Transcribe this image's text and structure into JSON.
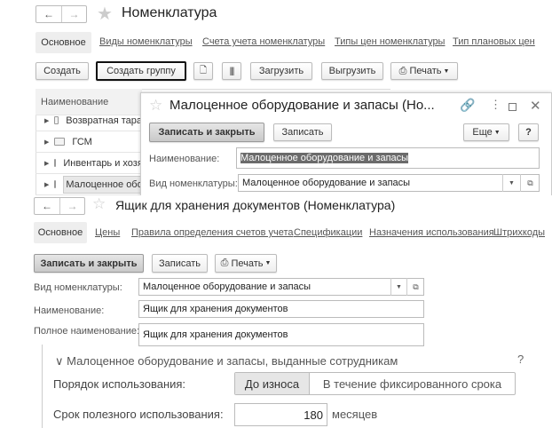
{
  "list_window": {
    "title": "Номенклатура",
    "tabs": [
      "Основное",
      "Виды номенклатуры",
      "Счета учета номенклатуры",
      "Типы цен номенклатуры",
      "Тип плановых цен"
    ],
    "toolbar": {
      "create": "Создать",
      "create_group": "Создать группу",
      "load": "Загрузить",
      "unload": "Выгрузить",
      "print": "Печать"
    },
    "column_header": "Наименование",
    "rows": [
      "Возвратная тара",
      "ГСМ",
      "Инвентарь и хозяйственные принадлежности",
      "Малоценное оборудование и запасы"
    ]
  },
  "group_dialog": {
    "title": "Малоценное оборудование и запасы (Но...",
    "save_close": "Записать и закрыть",
    "save": "Записать",
    "more": "Еще",
    "help": "?",
    "name_label": "Наименование:",
    "name_value": "Малоценное оборудование и запасы",
    "kind_label": "Вид номенклатуры:",
    "kind_value": "Малоценное оборудование и запасы"
  },
  "item_form": {
    "title": "Ящик для хранения документов (Номенклатура)",
    "tabs": [
      "Основное",
      "Цены",
      "Правила определения счетов учета",
      "Спецификации",
      "Назначения использования",
      "Штрихкоды"
    ],
    "save_close": "Записать и закрыть",
    "save": "Записать",
    "print": "Печать",
    "kind_label": "Вид номенклатуры:",
    "kind_value": "Малоценное оборудование и запасы",
    "name_label": "Наименование:",
    "name_value": "Ящик для хранения документов",
    "full_name_label": "Полное наименование:",
    "full_name_value": "Ящик для хранения документов"
  },
  "lvp_group": {
    "header": "Малоценное оборудование и запасы, выданные сотрудникам",
    "help": "?",
    "usage_label": "Порядок использования:",
    "usage_options": [
      "До износа",
      "В течение фиксированного срока"
    ],
    "usage_selected": "До износа",
    "life_label": "Срок полезного использования:",
    "life_value": "180",
    "life_unit": "месяцев"
  }
}
